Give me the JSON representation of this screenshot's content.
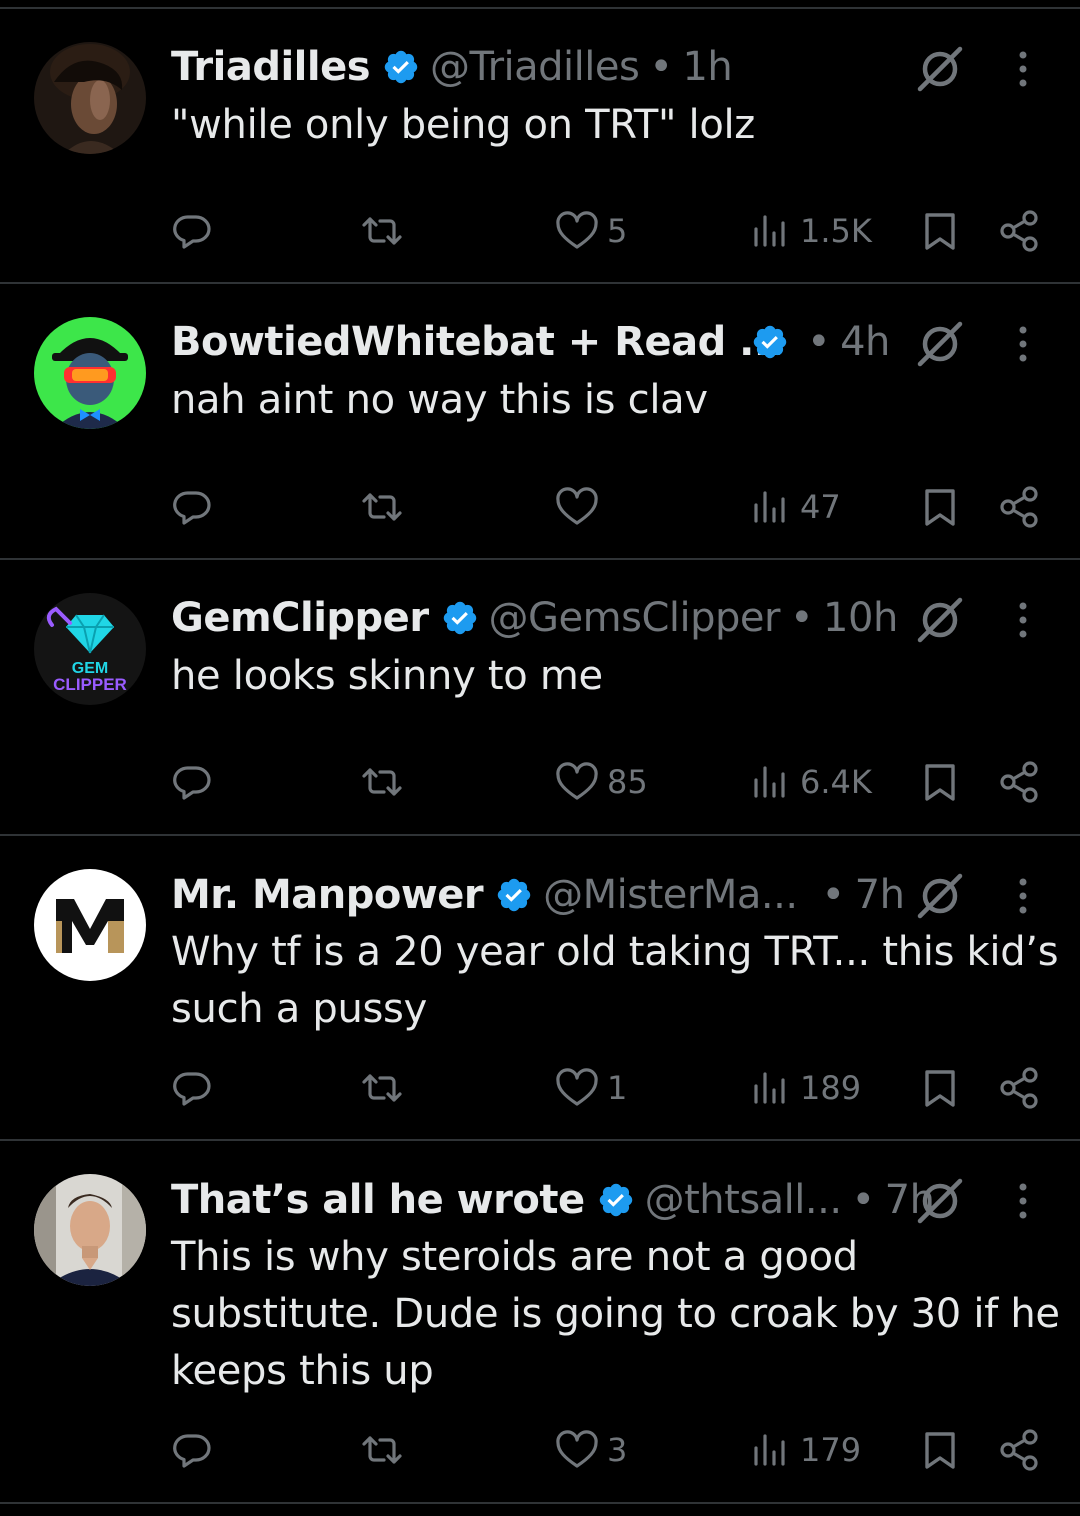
{
  "colors": {
    "background": "#000000",
    "separator": "#2f3336",
    "text": "#e7e9ea",
    "muted": "#71767b",
    "verified": "#1d9bf0"
  },
  "tweets": [
    {
      "name": "Triadilles",
      "handle": "@Triadilles",
      "dot": "•",
      "time": "1h",
      "text": "\"while only being on TRT\" lolz",
      "replies": "",
      "reposts": "",
      "likes": "5",
      "views": "1.5K",
      "avatar": "photo-avatar"
    },
    {
      "name": "BowtiedWhitebat + Read ...",
      "handle": "",
      "dot": "•",
      "time": "4h",
      "text": "nah aint no way this is clav",
      "replies": "",
      "reposts": "",
      "likes": "",
      "views": "47",
      "avatar": "cartoon-avatar"
    },
    {
      "name": "GemClipper",
      "handle": "@GemsClipper",
      "dot": "•",
      "time": "10h",
      "text": "he looks skinny to me",
      "replies": "",
      "reposts": "",
      "likes": "85",
      "views": "6.4K",
      "avatar": "logo-avatar",
      "logo_text_1": "GEM",
      "logo_text_2": "CLIPPER"
    },
    {
      "name": "Mr. Manpower",
      "handle": "@MisterMa...",
      "dot": "•",
      "time": "7h",
      "text": "Why tf is a 20 year old taking TRT... this kid’s such a pussy",
      "replies": "",
      "reposts": "",
      "likes": "1",
      "views": "189",
      "avatar": "logo-avatar",
      "logo_letter": "M"
    },
    {
      "name": "That’s all he wrote",
      "handle": "@thtsall...",
      "dot": "•",
      "time": "7h",
      "text": "This is why steroids are not a good substitute. Dude is going to croak by 30 if he keeps this up",
      "replies": "",
      "reposts": "",
      "likes": "3",
      "views": "179",
      "avatar": "photo-avatar"
    }
  ]
}
